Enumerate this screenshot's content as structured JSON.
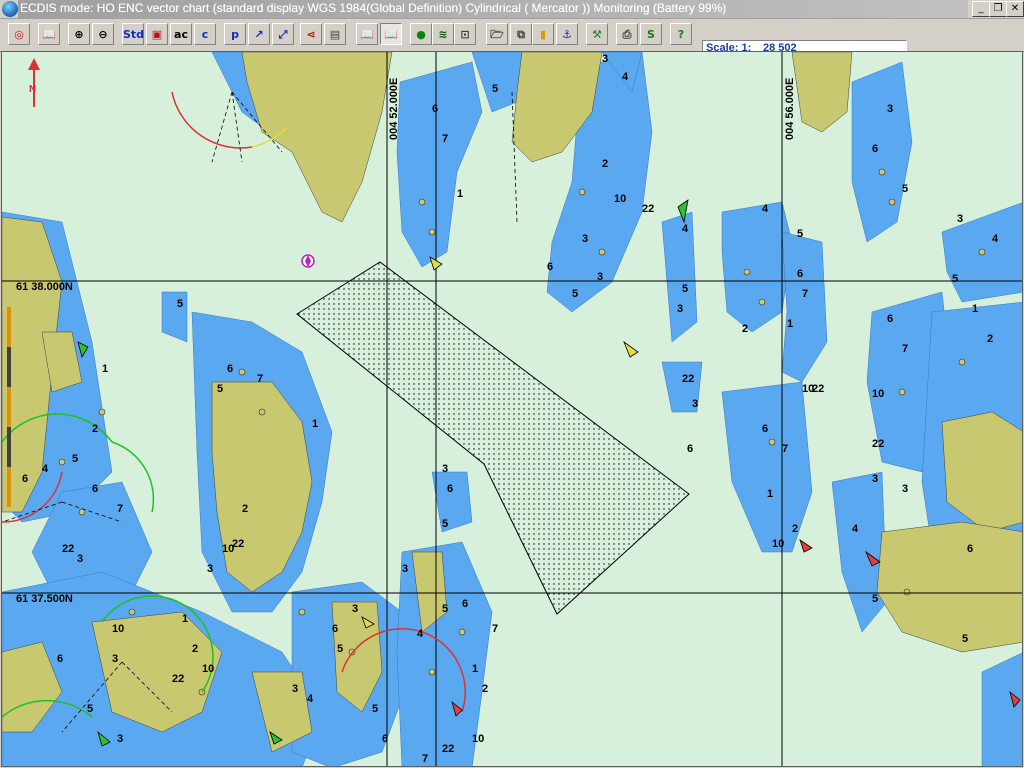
{
  "window": {
    "title": "ECDIS mode: HO ENC vector chart (standard display  WGS 1984(Global Definition)  Cylindrical ( Mercator )) Monitoring  (Battery  99%)",
    "minimize_glyph": "_",
    "restore_glyph": "❐",
    "close_glyph": "✕"
  },
  "toolbar": {
    "buttons": [
      {
        "name": "target-icon",
        "glyph": "◎",
        "color": "#d01010"
      },
      {
        "name": "book-icon",
        "glyph": "📖",
        "color": "#a02020"
      },
      {
        "name": "zoom-in-icon",
        "glyph": "⊕",
        "color": "#000000"
      },
      {
        "name": "zoom-out-icon",
        "glyph": "⊖",
        "color": "#000000"
      },
      {
        "name": "standard-display-icon",
        "glyph": "Std",
        "color": "#1030c0"
      },
      {
        "name": "layers-icon",
        "glyph": "▣",
        "color": "#c01010"
      },
      {
        "name": "text-a-icon",
        "glyph": "ac",
        "color": "#000000"
      },
      {
        "name": "text-c-icon",
        "glyph": "c",
        "color": "#1030c0"
      },
      {
        "name": "depth-p-icon",
        "glyph": "p",
        "color": "#1030c0"
      },
      {
        "name": "route-icon",
        "glyph": "↗",
        "color": "#1030c0"
      },
      {
        "name": "route-edit-icon",
        "glyph": "⤢",
        "color": "#1030c0"
      },
      {
        "name": "share-icon",
        "glyph": "⋖",
        "color": "#c01010"
      },
      {
        "name": "table-icon",
        "glyph": "▤",
        "color": "#404040"
      },
      {
        "name": "book-open-icon",
        "glyph": "📖",
        "color": "#c01010"
      },
      {
        "name": "book-open-pressed-icon",
        "glyph": "📖",
        "color": "#c01010"
      },
      {
        "name": "dot-icon",
        "glyph": "●",
        "color": "#108010"
      },
      {
        "name": "waves-icon",
        "glyph": "≋",
        "color": "#106010"
      },
      {
        "name": "fit-icon",
        "glyph": "⊡",
        "color": "#404040"
      },
      {
        "name": "folder-icon",
        "glyph": "🗁",
        "color": "#404040"
      },
      {
        "name": "copy-icon",
        "glyph": "⧉",
        "color": "#404040"
      },
      {
        "name": "traffic-light-icon",
        "glyph": "▮",
        "color": "#d0a000"
      },
      {
        "name": "anchor-icon",
        "glyph": "⚓",
        "color": "#1030c0"
      },
      {
        "name": "hammer-icon",
        "glyph": "⚒",
        "color": "#208020"
      },
      {
        "name": "print-icon",
        "glyph": "⎙",
        "color": "#404040"
      },
      {
        "name": "script-s-icon",
        "glyph": "S",
        "color": "#108010"
      },
      {
        "name": "help-icon",
        "glyph": "?",
        "color": "#108010"
      }
    ],
    "scale_label": "Scale: 1:",
    "scale_value": "28 502"
  },
  "chart": {
    "lon_labels": [
      "004 52.000E",
      "004 56.000E"
    ],
    "lat_labels": [
      "61 38.000N",
      "61 37.500N"
    ],
    "sea_color": "#d6f0dc",
    "shallow_color": "#5aa8f0",
    "land_color": "#c8c870",
    "north_arrow_label": "N",
    "soundings": [
      "3",
      "4",
      "5",
      "6",
      "7",
      "1",
      "2",
      "10",
      "22",
      "3",
      "6",
      "5"
    ]
  }
}
